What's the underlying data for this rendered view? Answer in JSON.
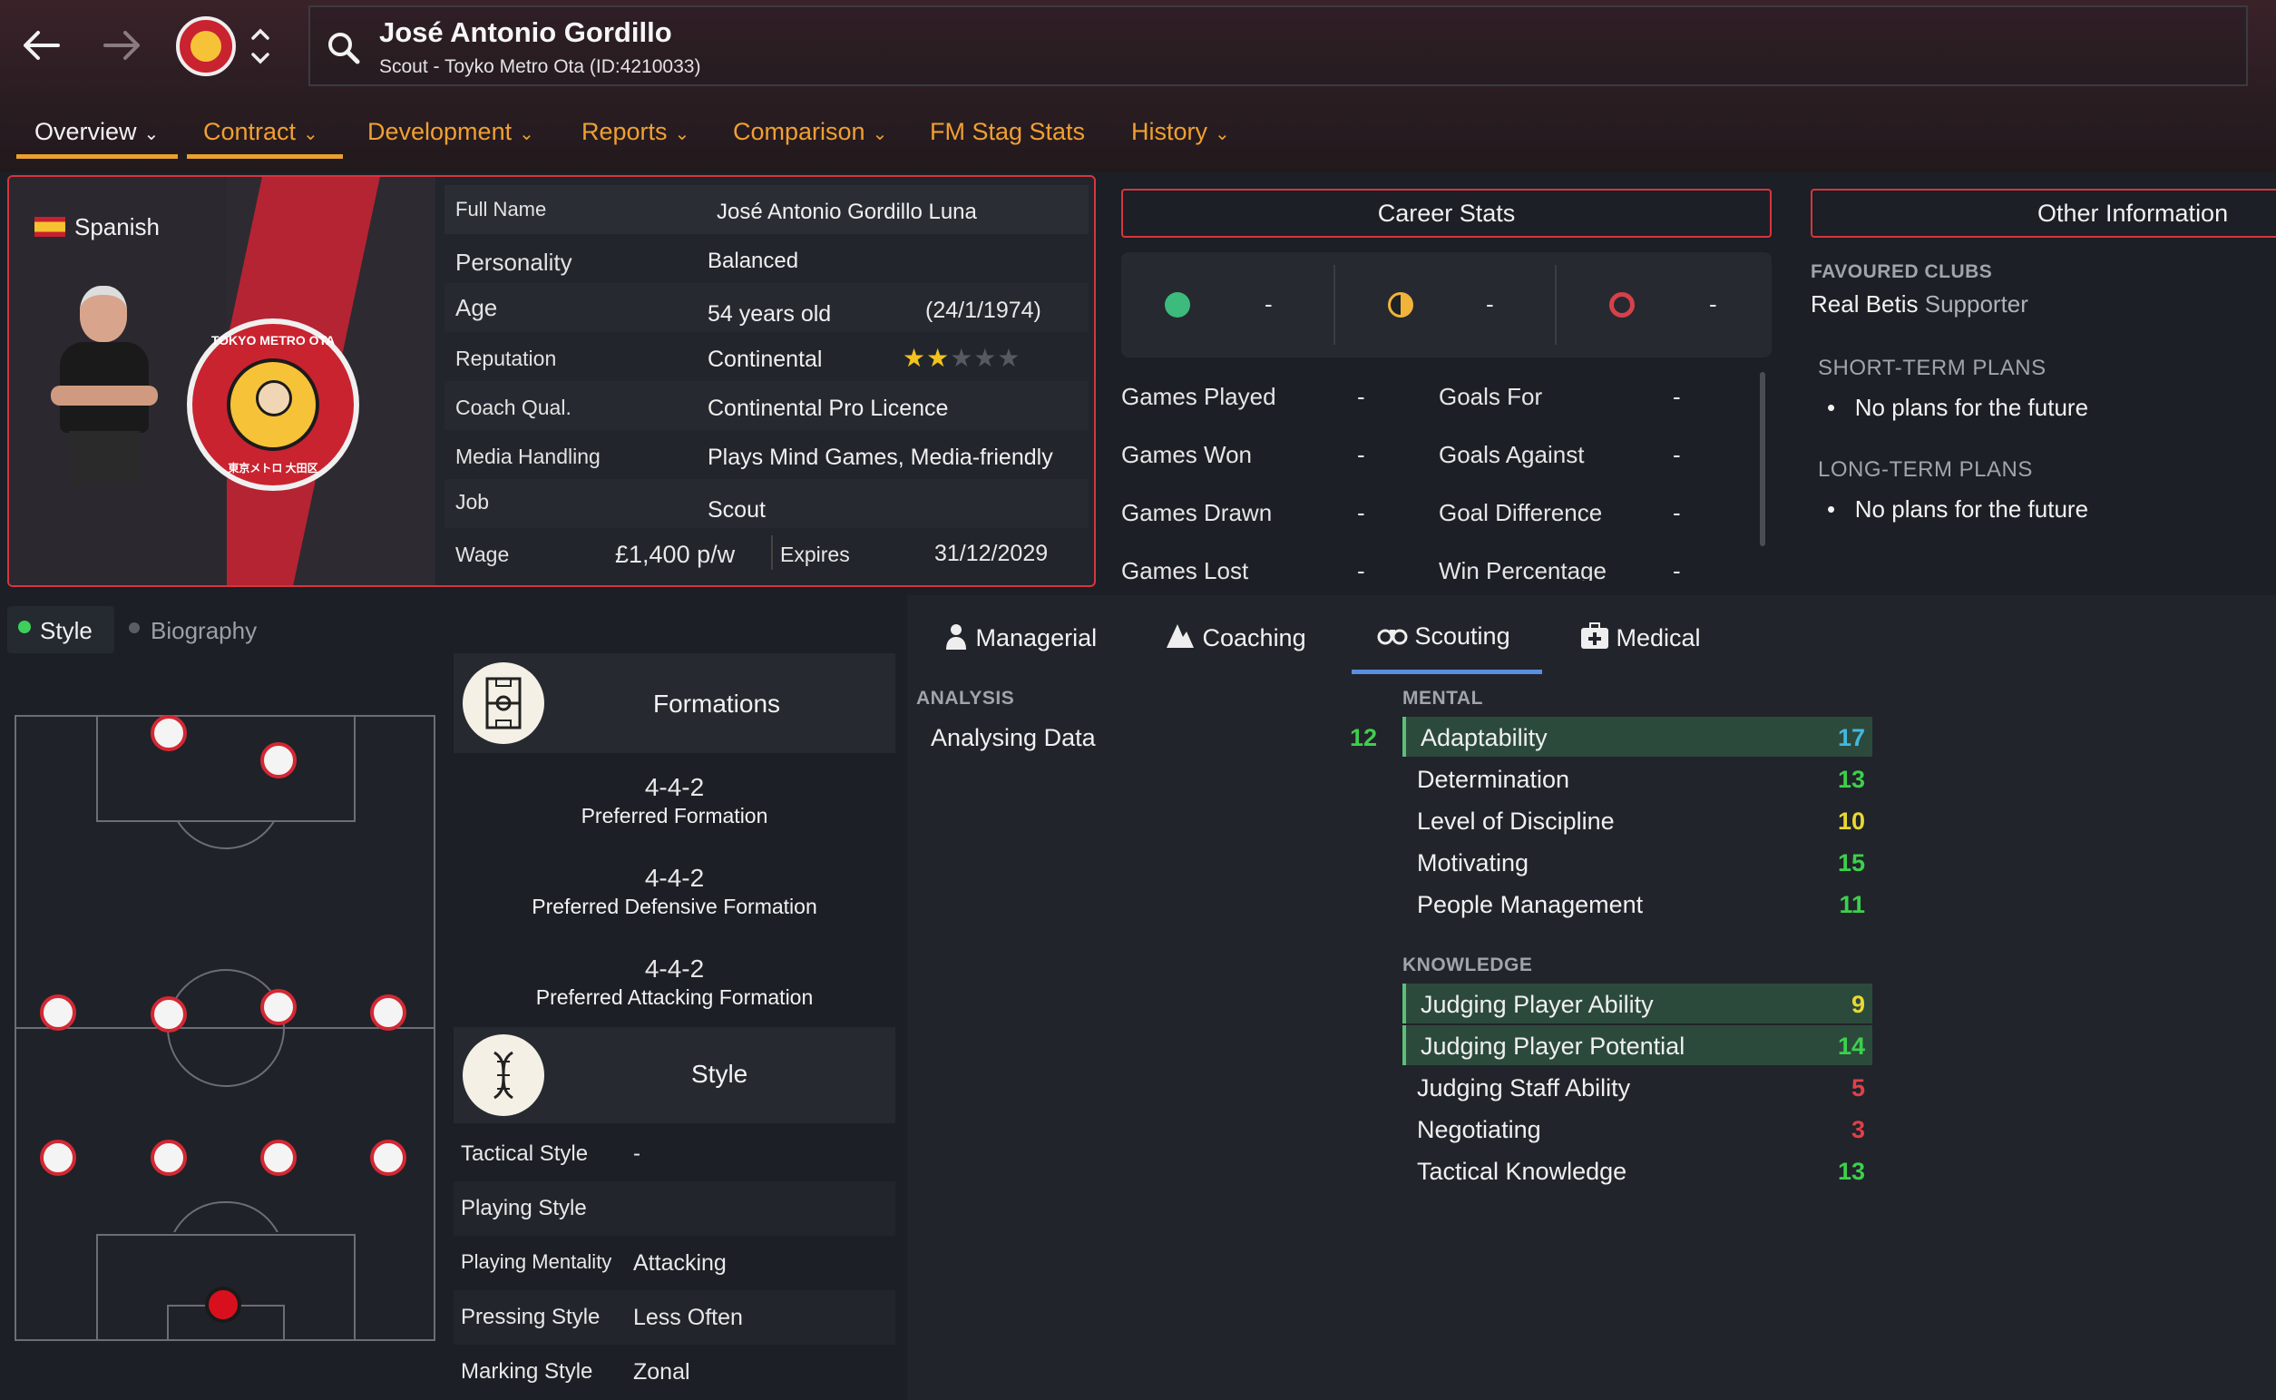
{
  "header": {
    "name": "José Antonio Gordillo",
    "subtitle": "Scout - Toyko Metro Ota (ID:4210033)",
    "club_badge_text": "TOKYO METRO OTA"
  },
  "tabs": [
    {
      "label": "Overview",
      "dropdown": true
    },
    {
      "label": "Contract",
      "dropdown": true
    },
    {
      "label": "Development",
      "dropdown": true
    },
    {
      "label": "Reports",
      "dropdown": true
    },
    {
      "label": "Comparison",
      "dropdown": true
    },
    {
      "label": "FM Stag Stats",
      "dropdown": false
    },
    {
      "label": "History",
      "dropdown": true
    }
  ],
  "profile": {
    "nationality": "Spanish",
    "club_badge_text": "TOKYO METRO OTA",
    "club_badge_sub": "東京メトロ 大田区",
    "rows": [
      {
        "label": "Full Name",
        "value": "José Antonio Gordillo Luna"
      },
      {
        "label": "Personality",
        "value": "Balanced"
      },
      {
        "label": "Age",
        "value": "54 years old",
        "extra": "(24/1/1974)"
      },
      {
        "label": "Reputation",
        "value": "Continental"
      },
      {
        "label": "Coach Qual.",
        "value": "Continental Pro Licence"
      },
      {
        "label": "Media Handling",
        "value": "Plays Mind Games, Media-friendly"
      },
      {
        "label": "Job",
        "value": "Scout"
      }
    ],
    "reputation_stars": 2,
    "reputation_stars_max": 5,
    "wage_label": "Wage",
    "wage": "£1,400 p/w",
    "expires_label": "Expires",
    "expires": "31/12/2029"
  },
  "career": {
    "title": "Career Stats",
    "summary": [
      "-",
      "-",
      "-"
    ],
    "rows": [
      {
        "l1": "Games Played",
        "v1": "-",
        "l2": "Goals For",
        "v2": "-"
      },
      {
        "l1": "Games Won",
        "v1": "-",
        "l2": "Goals Against",
        "v2": "-"
      },
      {
        "l1": "Games Drawn",
        "v1": "-",
        "l2": "Goal Difference",
        "v2": "-"
      },
      {
        "l1": "Games Lost",
        "v1": "-",
        "l2": "Win Percentage",
        "v2": "-"
      }
    ]
  },
  "other": {
    "title": "Other Information",
    "fav_head": "FAVOURED CLUBS",
    "fav_club": "Real Betis",
    "fav_role": "Supporter",
    "short_head": "SHORT-TERM PLANS",
    "short_item": "No plans for the future",
    "long_head": "LONG-TERM PLANS",
    "long_item": "No plans for the future"
  },
  "lower_tabs": {
    "style": "Style",
    "biography": "Biography"
  },
  "formations": {
    "title": "Formations",
    "preferred": "4-4-2",
    "preferred_label": "Preferred Formation",
    "defensive": "4-4-2",
    "defensive_label": "Preferred Defensive Formation",
    "attacking": "4-4-2",
    "attacking_label": "Preferred Attacking Formation"
  },
  "style": {
    "title": "Style",
    "rows": [
      {
        "label": "Tactical Style",
        "value": "-"
      },
      {
        "label": "Playing Style",
        "value": ""
      },
      {
        "label": "Playing Mentality",
        "value": "Attacking"
      },
      {
        "label": "Pressing Style",
        "value": "Less Often"
      },
      {
        "label": "Marking Style",
        "value": "Zonal"
      }
    ]
  },
  "attr_tabs": [
    "Managerial",
    "Coaching",
    "Scouting",
    "Medical"
  ],
  "attributes": {
    "analysis_head": "ANALYSIS",
    "analysis": [
      {
        "name": "Analysing Data",
        "value": "12"
      }
    ],
    "mental_head": "MENTAL",
    "mental": [
      {
        "name": "Adaptability",
        "value": "17"
      },
      {
        "name": "Determination",
        "value": "13"
      },
      {
        "name": "Level of Discipline",
        "value": "10"
      },
      {
        "name": "Motivating",
        "value": "15"
      },
      {
        "name": "People Management",
        "value": "11"
      }
    ],
    "knowledge_head": "KNOWLEDGE",
    "knowledge": [
      {
        "name": "Judging Player Ability",
        "value": "9"
      },
      {
        "name": "Judging Player Potential",
        "value": "14"
      },
      {
        "name": "Judging Staff Ability",
        "value": "5"
      },
      {
        "name": "Negotiating",
        "value": "3"
      },
      {
        "name": "Tactical Knowledge",
        "value": "13"
      }
    ]
  },
  "colors": {
    "accent": "#d7353f",
    "tab_orange": "#f0a032",
    "attr_high": "#42b8e0",
    "attr_good": "#3cd04c",
    "attr_mid": "#e8d832",
    "attr_low": "#e0404a"
  }
}
